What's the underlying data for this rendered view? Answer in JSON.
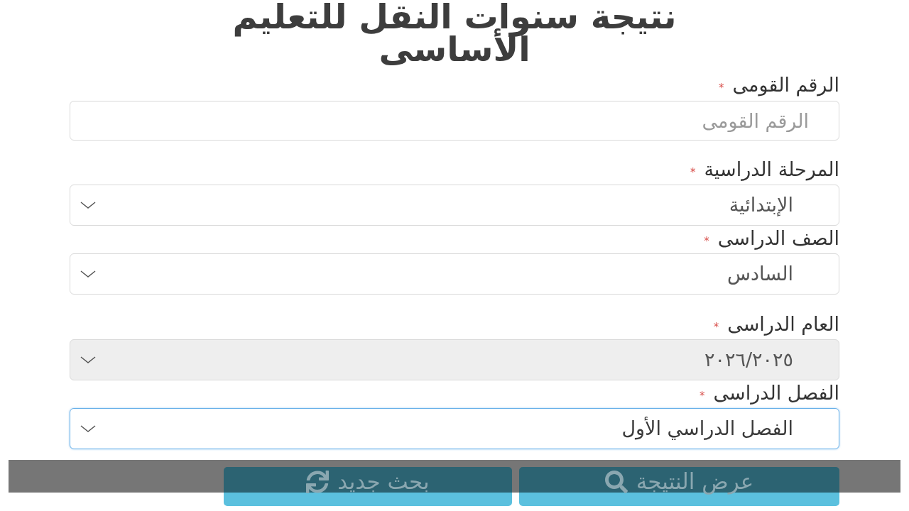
{
  "title": "نتيجة سنوات النقل للتعليم الأساسى",
  "fields": [
    {
      "kind": "input",
      "label": "الرقم القومى",
      "required_mark": "*",
      "placeholder": "الرقم القومى",
      "disabled": false,
      "focused": false
    },
    {
      "kind": "select",
      "label": "المرحلة الدراسية",
      "required_mark": "*",
      "value": "الإبتدائية",
      "disabled": false,
      "focused": false
    },
    {
      "kind": "select",
      "label": "الصف الدراسى",
      "required_mark": "*",
      "value": "السادس",
      "disabled": false,
      "focused": false
    },
    {
      "kind": "select",
      "label": "العام الدراسى",
      "required_mark": "*",
      "value": "٢٠٢٦/٢٠٢٥",
      "disabled": true,
      "focused": false
    },
    {
      "kind": "select",
      "label": "الفصل الدراسى",
      "required_mark": "*",
      "value": "الفصل الدراسي الأول",
      "disabled": false,
      "focused": true
    }
  ],
  "buttons": [
    {
      "kind": "submit",
      "label": "عرض النتيجة"
    },
    {
      "kind": "reset",
      "label": "بحث جديد"
    }
  ]
}
